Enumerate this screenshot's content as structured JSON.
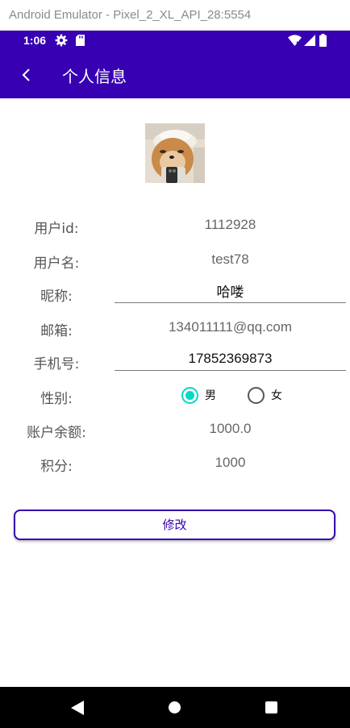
{
  "window": {
    "title": "Android Emulator - Pixel_2_XL_API_28:5554"
  },
  "status_bar": {
    "time": "1:06",
    "icons": [
      "gear-icon",
      "sd-card-icon",
      "wifi-icon",
      "signal-icon",
      "battery-icon"
    ]
  },
  "app_bar": {
    "title": "个人信息",
    "back_icon": "chevron-left-icon"
  },
  "avatar": {
    "description_icon": "dog-avatar"
  },
  "profile": {
    "user_id_label": "用户id:",
    "user_id_value": "1112928",
    "username_label": "用户名:",
    "username_value": "test78",
    "nickname_label": "昵称:",
    "nickname_value": "哈喽",
    "email_label": "邮箱:",
    "email_value": "134011111@qq.com",
    "phone_label": "手机号:",
    "phone_value": "17852369873",
    "gender_label": "性别:",
    "gender_options": [
      {
        "label": "男",
        "checked": true
      },
      {
        "label": "女",
        "checked": false
      }
    ],
    "balance_label": "账户余额:",
    "balance_value": "1000.0",
    "points_label": "积分:",
    "points_value": "1000"
  },
  "actions": {
    "modify_label": "修改"
  },
  "nav_bar": {
    "icons": [
      "back-triangle-icon",
      "home-circle-icon",
      "recents-square-icon"
    ]
  },
  "colors": {
    "primary": "#3700b3",
    "accent": "#03dac5",
    "nav_bar": "#000000"
  }
}
